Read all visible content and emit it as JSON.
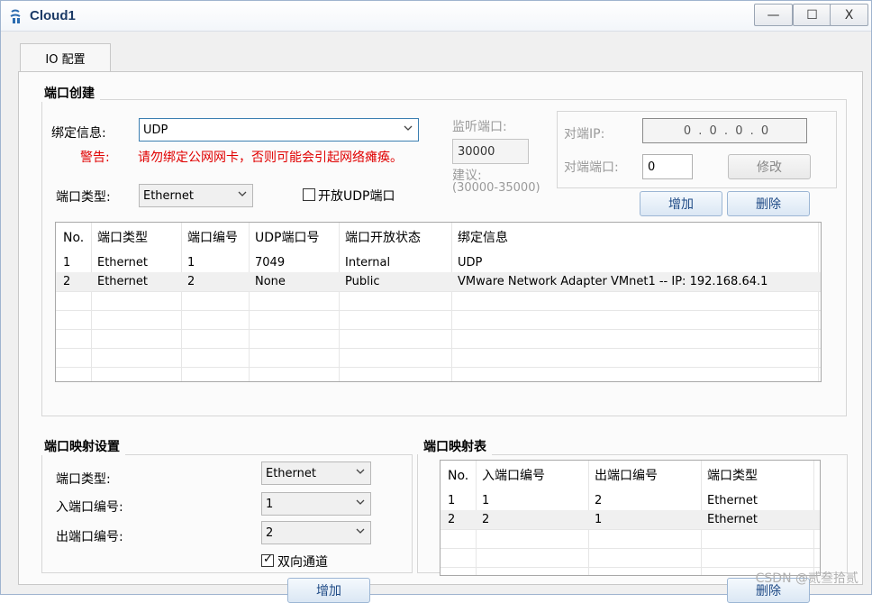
{
  "window": {
    "title": "Cloud1",
    "minimize_glyph": "—",
    "maximize_glyph": "☐",
    "close_glyph": "X"
  },
  "tabs": [
    {
      "label": "IO 配置"
    }
  ],
  "port_create": {
    "group_title": "端口创建",
    "bind_label": "绑定信息:",
    "bind_value": "UDP",
    "warning_label": "警告:",
    "warning_text": "请勿绑定公网网卡，否则可能会引起网络瘫痪。",
    "port_type_label": "端口类型:",
    "port_type_value": "Ethernet",
    "open_udp_label": "开放UDP端口",
    "open_udp_checked": false,
    "listen_port_label": "监听端口:",
    "listen_port_value": "30000",
    "suggest_label": "建议:",
    "suggest_range": "(30000-35000)",
    "peer_ip_label": "对端IP:",
    "peer_ip_value": "0 . 0 . 0 . 0",
    "peer_port_label": "对端端口:",
    "peer_port_value": "0",
    "modify_label": "修改",
    "add_label": "增加",
    "delete_label": "删除"
  },
  "port_table": {
    "columns": [
      "No.",
      "端口类型",
      "端口编号",
      "UDP端口号",
      "端口开放状态",
      "绑定信息"
    ],
    "rows": [
      [
        "1",
        "Ethernet",
        "1",
        "7049",
        "Internal",
        "UDP"
      ],
      [
        "2",
        "Ethernet",
        "2",
        "None",
        "Public",
        "VMware Network Adapter VMnet1 -- IP: 192.168.64.1"
      ]
    ]
  },
  "port_mapping": {
    "group_title": "端口映射设置",
    "port_type_label": "端口类型:",
    "port_type_value": "Ethernet",
    "in_port_label": "入端口编号:",
    "in_port_value": "1",
    "out_port_label": "出端口编号:",
    "out_port_value": "2",
    "bidirectional_label": "双向通道",
    "bidirectional_checked": true,
    "add_label": "增加"
  },
  "mapping_table": {
    "group_title": "端口映射表",
    "columns": [
      "No.",
      "入端口编号",
      "出端口编号",
      "端口类型"
    ],
    "rows": [
      [
        "1",
        "1",
        "2",
        "Ethernet"
      ],
      [
        "2",
        "2",
        "1",
        "Ethernet"
      ]
    ],
    "delete_label": "删除"
  },
  "watermark": "CSDN @贰叁拾贰"
}
